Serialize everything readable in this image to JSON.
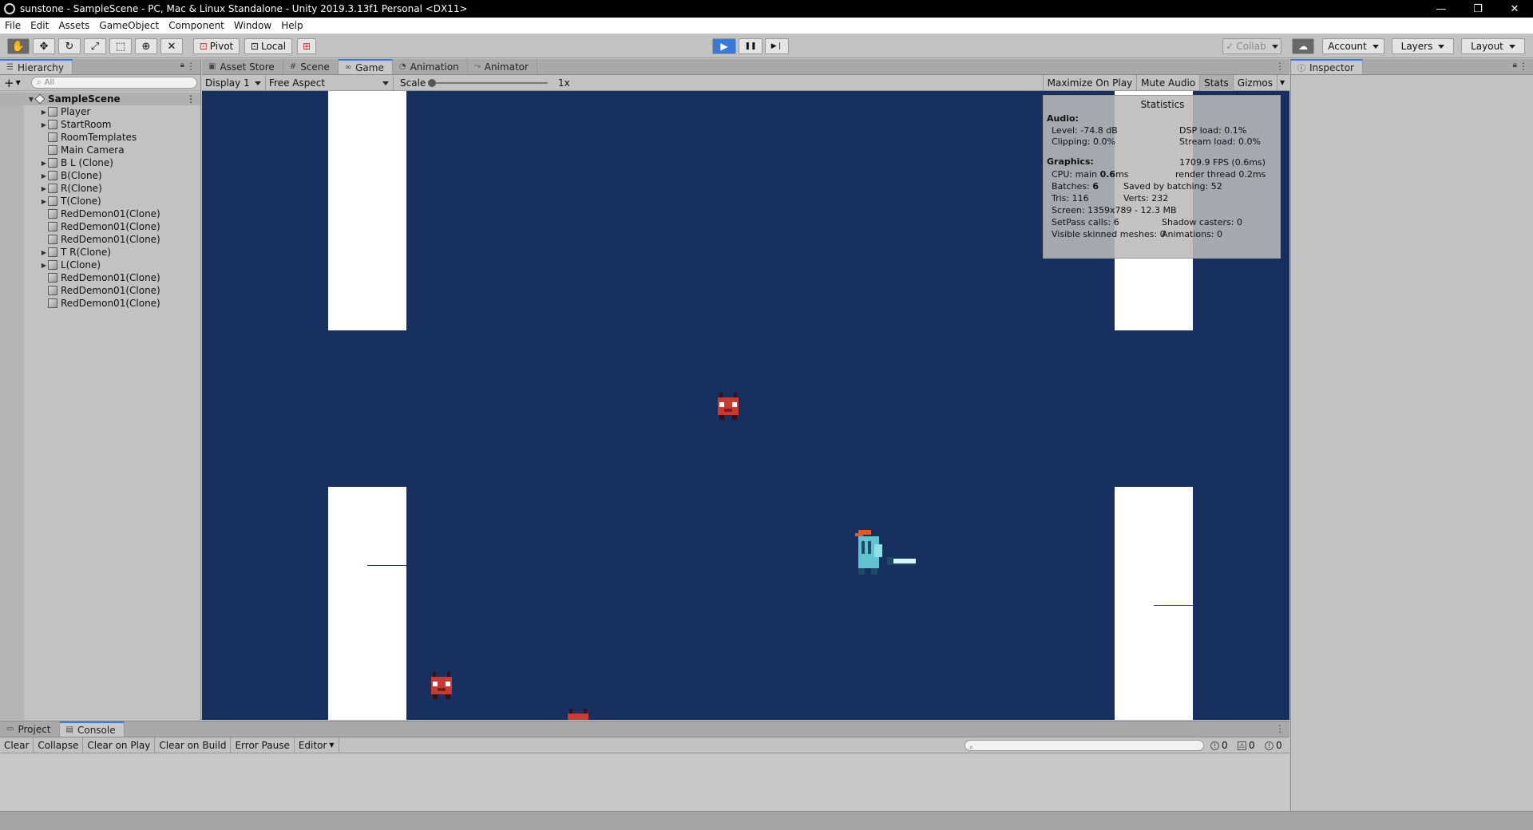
{
  "window": {
    "title": "sunstone - SampleScene - PC, Mac & Linux Standalone - Unity 2019.3.13f1 Personal <DX11>",
    "minimize_glyph": "—",
    "restore_glyph": "❐",
    "close_glyph": "✕"
  },
  "menu": [
    "File",
    "Edit",
    "Assets",
    "GameObject",
    "Component",
    "Window",
    "Help"
  ],
  "toolbar": {
    "pivot_label": "Pivot",
    "local_label": "Local",
    "collab_label": "Collab",
    "account_label": "Account",
    "layers_label": "Layers",
    "layout_label": "Layout",
    "play_glyph": "▶",
    "pause_glyph": "❚❚",
    "step_glyph": "▶❘"
  },
  "hierarchy": {
    "tab_label": "Hierarchy",
    "search_placeholder": "All",
    "scene_name": "SampleScene",
    "items": [
      {
        "label": "Player",
        "expandable": true
      },
      {
        "label": "StartRoom",
        "expandable": true
      },
      {
        "label": "RoomTemplates",
        "expandable": false
      },
      {
        "label": "Main Camera",
        "expandable": false
      },
      {
        "label": "B L (Clone)",
        "expandable": true
      },
      {
        "label": "B(Clone)",
        "expandable": true
      },
      {
        "label": "R(Clone)",
        "expandable": true
      },
      {
        "label": "T(Clone)",
        "expandable": true
      },
      {
        "label": "RedDemon01(Clone)",
        "expandable": false
      },
      {
        "label": "RedDemon01(Clone)",
        "expandable": false
      },
      {
        "label": "RedDemon01(Clone)",
        "expandable": false
      },
      {
        "label": "T R(Clone)",
        "expandable": true
      },
      {
        "label": "L(Clone)",
        "expandable": true
      },
      {
        "label": "RedDemon01(Clone)",
        "expandable": false
      },
      {
        "label": "RedDemon01(Clone)",
        "expandable": false
      },
      {
        "label": "RedDemon01(Clone)",
        "expandable": false
      }
    ]
  },
  "center_tabs": [
    {
      "label": "Asset Store",
      "active": false
    },
    {
      "label": "Scene",
      "active": false
    },
    {
      "label": "Game",
      "active": true
    },
    {
      "label": "Animation",
      "active": false
    },
    {
      "label": "Animator",
      "active": false
    }
  ],
  "game_toolbar": {
    "display": "Display 1",
    "aspect": "Free Aspect",
    "scale_label": "Scale",
    "scale_value": "1x",
    "scale_slider": 0,
    "maximize": "Maximize On Play",
    "mute": "Mute Audio",
    "stats": "Stats",
    "gizmos": "Gizmos"
  },
  "statistics": {
    "title": "Statistics",
    "audio_header": "Audio:",
    "level": "Level: -74.8 dB",
    "clipping": "Clipping: 0.0%",
    "dsp_load": "DSP load: 0.1%",
    "stream_load": "Stream load: 0.0%",
    "graphics_header": "Graphics:",
    "fps": "1709.9 FPS (0.6ms)",
    "cpu_prefix": "CPU: main ",
    "cpu_main": "0.6",
    "cpu_suffix": "ms",
    "render_thread": "render thread 0.2ms",
    "batches_prefix": "Batches: ",
    "batches": "6",
    "saved_by_batching": "Saved by batching: 52",
    "tris": "Tris: 116",
    "verts": "Verts: 232",
    "screen": "Screen: 1359x789 - 12.3 MB",
    "setpass": "SetPass calls: 6",
    "shadow_casters": "Shadow casters: 0",
    "skinned": "Visible skinned meshes: 0",
    "animations": "Animations: 0"
  },
  "inspector": {
    "tab_label": "Inspector"
  },
  "bottom_tabs": [
    {
      "label": "Project",
      "active": false
    },
    {
      "label": "Console",
      "active": true
    }
  ],
  "console": {
    "clear": "Clear",
    "collapse": "Collapse",
    "clear_on_play": "Clear on Play",
    "clear_on_build": "Clear on Build",
    "error_pause": "Error Pause",
    "editor": "Editor",
    "info_count": "0",
    "warning_count": "0",
    "error_count": "0"
  },
  "colors": {
    "game_bg": "#17305f",
    "play_active": "#3a79d9",
    "pillar": "#ffffff"
  }
}
